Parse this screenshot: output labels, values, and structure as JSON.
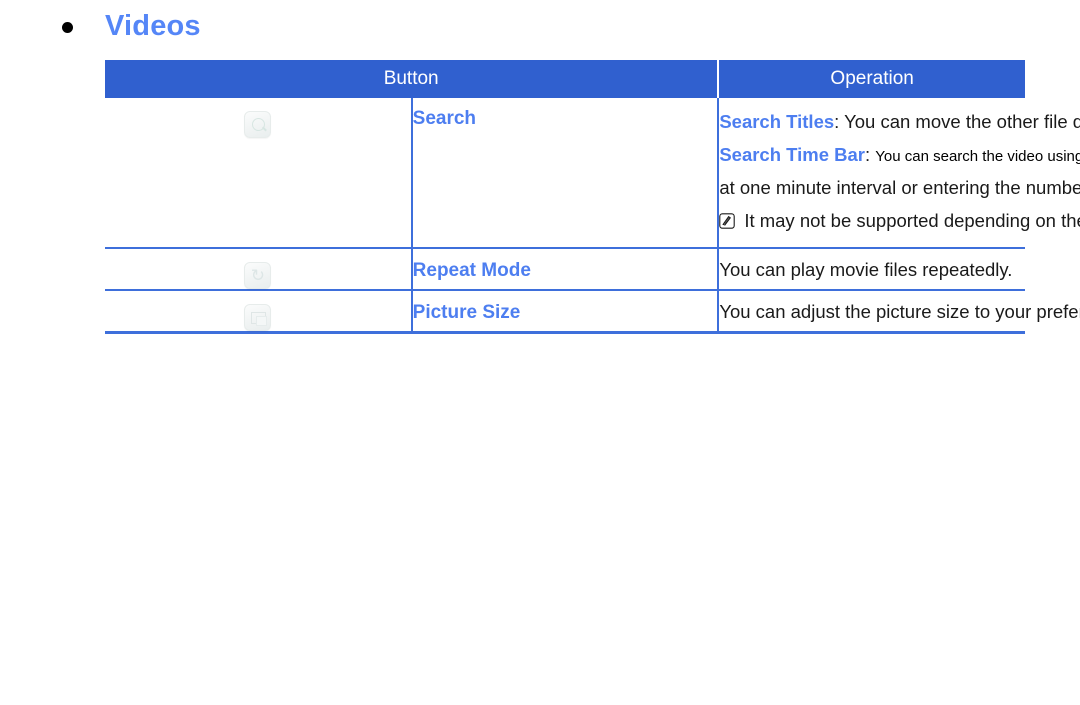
{
  "heading": {
    "bullet_icon": "bullet-dot-icon",
    "title": "Videos",
    "title_color": "#5586f7"
  },
  "table": {
    "header": {
      "button": "Button",
      "operation": "Operation",
      "background_color": "#3060cf",
      "text_color": "#ffffff"
    },
    "border_color": "#3e6fdb",
    "label_color": "#4d7ef0",
    "rows": [
      {
        "button_icon": "search-key-icon",
        "name": "Search",
        "operation_lines": [
          {
            "emphasis": "Search Titles",
            "separator": ": ",
            "text": "You can move the other file directly."
          },
          {
            "emphasis": "Search Time Bar",
            "separator": ": ",
            "text": "You can search the video using ◀ and ▶ button"
          },
          {
            "emphasis": "",
            "separator": "",
            "text": "at one minute interval or entering the number directly."
          }
        ],
        "note": {
          "icon": "note-pencil-icon",
          "text": "It may not be supported depending on the input source."
        }
      },
      {
        "button_icon": "repeat-key-icon",
        "name": "Repeat Mode",
        "operation": "You can play movie files repeatedly."
      },
      {
        "button_icon": "picture-size-key-icon",
        "name": "Picture Size",
        "operation": "You can adjust the picture size to your preference."
      }
    ]
  }
}
